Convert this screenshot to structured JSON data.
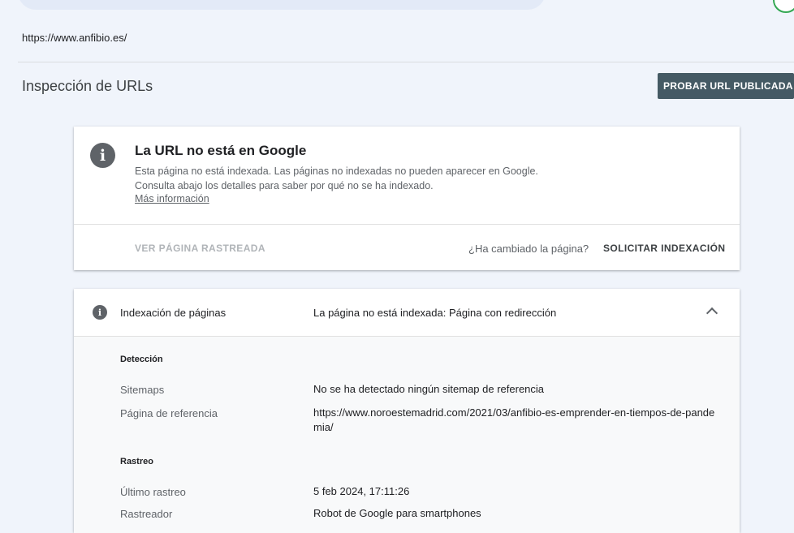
{
  "header": {
    "property_url": "https://www.anfibio.es/"
  },
  "page": {
    "title": "Inspección de URLs",
    "test_live_url_label": "PROBAR URL PUBLICADA"
  },
  "status_card": {
    "title": "La URL no está en Google",
    "description": "Esta página no está indexada. Las páginas no indexadas no pueden aparecer en Google. Consulta abajo los detalles para saber por qué no se ha indexado.",
    "learn_more": "Más información",
    "view_crawled_label": "VER PÁGINA RASTREADA",
    "page_changed_label": "¿Ha cambiado la página?",
    "request_indexing_label": "SOLICITAR INDEXACIÓN",
    "icon": "info-icon"
  },
  "indexing_card": {
    "label": "Indexación de páginas",
    "status": "La página no está indexada: Página con redirección",
    "icon": "info-icon",
    "discovery": {
      "heading": "Detección",
      "sitemaps_label": "Sitemaps",
      "sitemaps_value": "No se ha detectado ningún sitemap de referencia",
      "referring_page_label": "Página de referencia",
      "referring_page_value": "https://www.noroestemadrid.com/2021/03/anfibio-es-emprender-en-tiempos-de-pandemia/"
    },
    "crawl": {
      "heading": "Rastreo",
      "last_crawl_label": "Último rastreo",
      "last_crawl_value": "5 feb 2024, 17:11:26",
      "crawled_as_label": "Rastreador",
      "crawled_as_value": "Robot de Google para smartphones"
    }
  },
  "colors": {
    "background": "#f0f4fb",
    "primary_button": "#455a64",
    "icon_grey": "#5f6368"
  }
}
